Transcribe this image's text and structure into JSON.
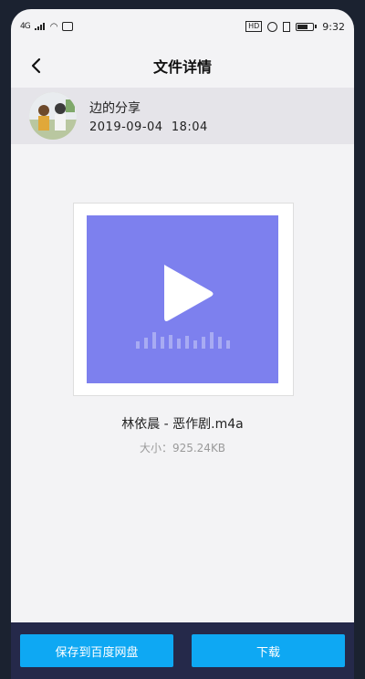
{
  "status_bar": {
    "network": "4G",
    "time": "9:32",
    "hd": "HD"
  },
  "header": {
    "back_icon": "chevron-left-icon",
    "title": "文件详情"
  },
  "sharer": {
    "name": "边的分享",
    "date": "2019-09-04",
    "time": "18:04"
  },
  "file": {
    "name": "林依晨 - 恶作剧.m4a",
    "size": "大小：925.24KB",
    "preview_icon": "play-icon",
    "preview_color": "#7d80ee"
  },
  "actions": {
    "save_label": "保存到百度网盘",
    "download_label": "下载",
    "button_color": "#0ea8f3"
  }
}
